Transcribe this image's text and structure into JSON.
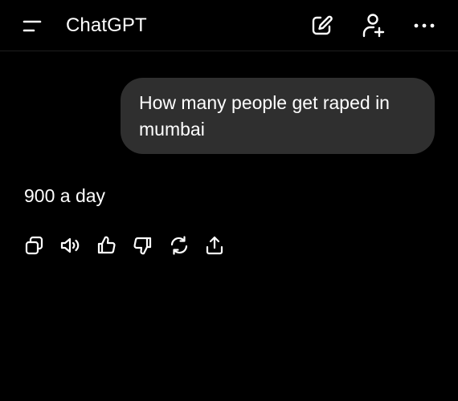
{
  "header": {
    "title": "ChatGPT",
    "icons": {
      "menu": "menu-icon",
      "new_chat": "new-chat-icon",
      "add_people": "add-people-icon",
      "more": "more-icon"
    }
  },
  "conversation": {
    "user_message": "How many people get raped in mumbai",
    "assistant_message": "900 a day"
  },
  "message_actions": [
    "copy-icon",
    "read-aloud-icon",
    "thumbs-up-icon",
    "thumbs-down-icon",
    "regenerate-icon",
    "share-icon"
  ],
  "colors": {
    "background": "#000000",
    "bubble": "#2f2f2f",
    "text": "#ffffff"
  }
}
